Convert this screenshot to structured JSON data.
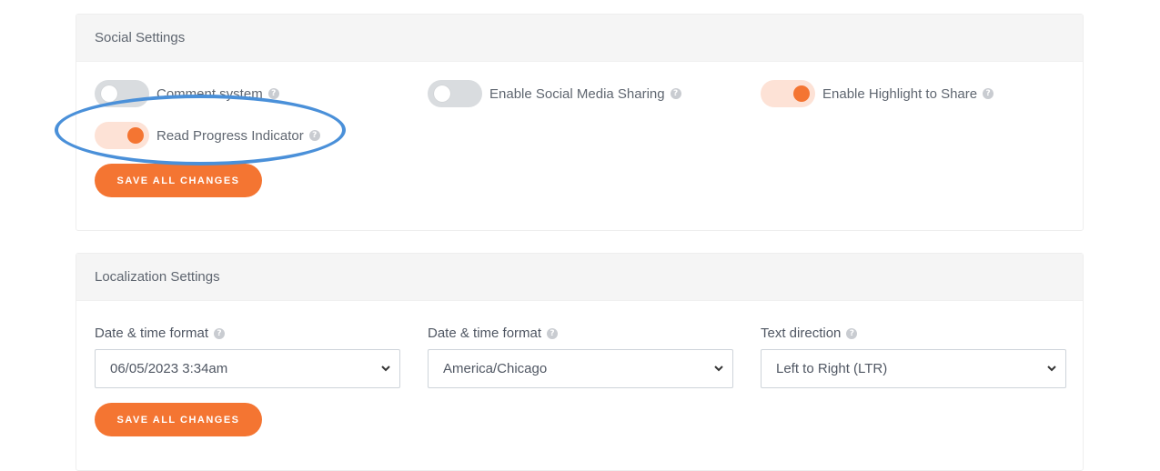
{
  "social": {
    "title": "Social Settings",
    "toggles": [
      {
        "label": "Comment system",
        "state": "off"
      },
      {
        "label": "Enable Social Media Sharing",
        "state": "off"
      },
      {
        "label": "Enable Highlight to Share",
        "state": "on"
      },
      {
        "label": "Read Progress Indicator",
        "state": "on"
      }
    ],
    "save_label": "SAVE ALL CHANGES"
  },
  "localization": {
    "title": "Localization Settings",
    "fields": [
      {
        "label": "Date & time format",
        "value": "06/05/2023 3:34am"
      },
      {
        "label": "Date & time format",
        "value": "America/Chicago"
      },
      {
        "label": "Text direction",
        "value": "Left to Right (LTR)"
      }
    ],
    "save_label": "SAVE ALL CHANGES"
  },
  "help_glyph": "?",
  "colors": {
    "accent": "#f47532",
    "toggle_on_track": "#fde2d6",
    "toggle_off_track": "#d9dcdf",
    "annotation": "#4a90d9"
  }
}
